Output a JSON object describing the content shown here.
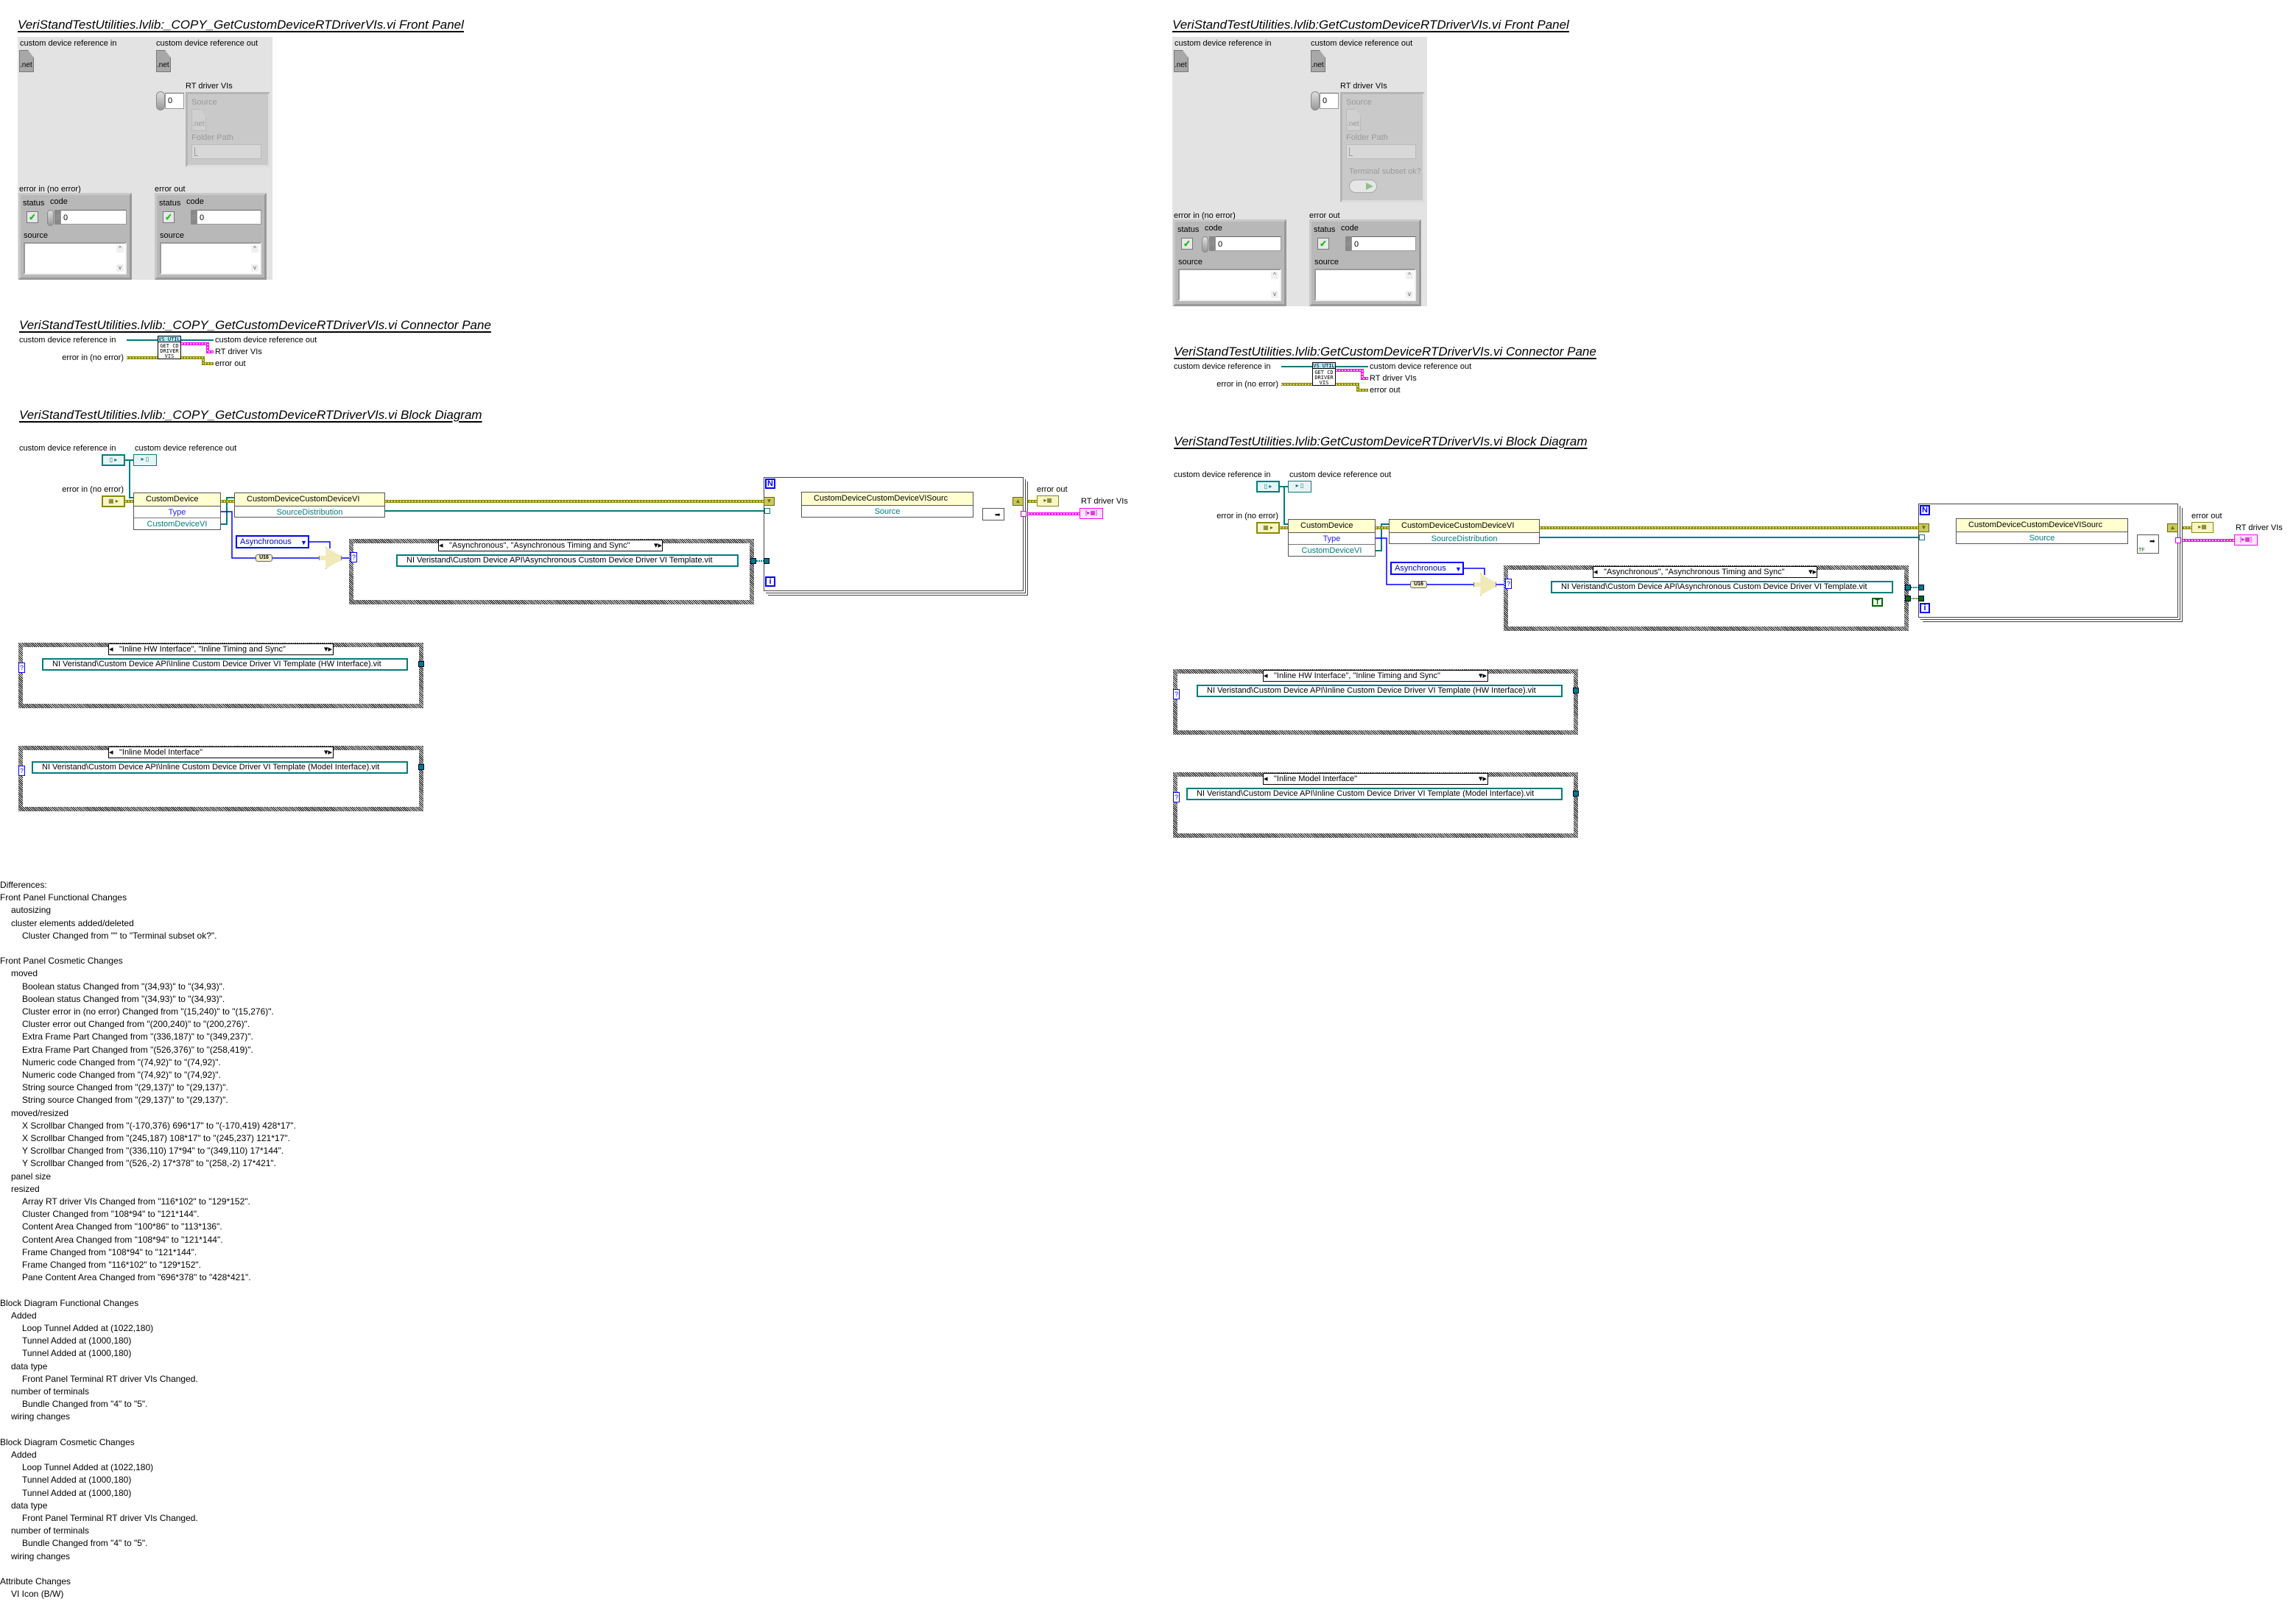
{
  "left": {
    "front_panel": {
      "title": "VeriStandTestUtilities.lvlib:_COPY_GetCustomDeviceRTDriverVIs.vi Front Panel",
      "ref_in_label": "custom device reference in",
      "ref_out_label": "custom device reference out",
      "net_icon_text": ".net",
      "array_label": "RT driver VIs",
      "array_index": "0",
      "source_label": "Source",
      "folder_path_label": "Folder Path",
      "error_in": {
        "label": "error in (no error)",
        "status_label": "status",
        "code_label": "code",
        "code_radix": "d",
        "code_value": "0",
        "source_label": "source",
        "status_value": "✓"
      },
      "error_out": {
        "label": "error out",
        "status_label": "status",
        "code_label": "code",
        "code_radix": "d",
        "code_value": "0",
        "source_label": "source",
        "status_value": "✓"
      }
    },
    "connector_pane": {
      "title": "VeriStandTestUtilities.lvlib:_COPY_GetCustomDeviceRTDriverVIs.vi Connector Pane",
      "ref_in": "custom device reference in",
      "error_in": "error in (no error)",
      "ref_out": "custom device reference out",
      "rt_driver_vis": "RT driver VIs",
      "error_out": "error out",
      "icon_lines": [
        "VS UTIL",
        "GET CD",
        "DRIVER",
        "VIS"
      ]
    },
    "block_diagram": {
      "title": "VeriStandTestUtilities.lvlib:_COPY_GetCustomDeviceRTDriverVIs.vi Block Diagram",
      "ref_in_label": "custom device reference in",
      "ref_out_label": "custom device reference out",
      "error_in_label": "error in (no error)",
      "property_node_1": {
        "class": "CustomDevice",
        "props": [
          "Type",
          "CustomDeviceVI"
        ]
      },
      "property_node_2": {
        "class": "CustomDeviceCustomDeviceVI",
        "props": [
          "SourceDistribution"
        ]
      },
      "enum_constant": "Asynchronous",
      "coerce_label": "U16",
      "case_selector_terminal": "?",
      "case_async": {
        "selector": "\"Asynchronous\", \"Asynchronous Timing and Sync\"",
        "path": "NI Veristand\\Custom Device API\\Asynchronous Custom Device Driver VI Template.vit"
      },
      "for_loop": {
        "count": "N",
        "index": "i"
      },
      "property_node_3": {
        "class": "CustomDeviceCustomDeviceVISourc",
        "props": [
          "Source"
        ]
      },
      "error_out_label": "error out",
      "rt_driver_vis_label": "RT driver VIs",
      "case_hw": {
        "selector": "\"Inline HW Interface\", \"Inline Timing and Sync\"",
        "path": "NI Veristand\\Custom Device API\\Inline Custom Device Driver VI Template (HW Interface).vit"
      },
      "case_model": {
        "selector": "\"Inline Model Interface\"",
        "path": "NI Veristand\\Custom Device API\\Inline Custom Device Driver VI Template (Model Interface).vit"
      }
    }
  },
  "right": {
    "front_panel": {
      "title": "VeriStandTestUtilities.lvlib:GetCustomDeviceRTDriverVIs.vi Front Panel",
      "ref_in_label": "custom device reference in",
      "ref_out_label": "custom device reference out",
      "net_icon_text": ".net",
      "array_label": "RT driver VIs",
      "array_index": "0",
      "source_label": "Source",
      "folder_path_label": "Folder Path",
      "terminal_subset_label": "Terminal subset ok?",
      "error_in": {
        "label": "error in (no error)",
        "status_label": "status",
        "code_label": "code",
        "code_radix": "d",
        "code_value": "0",
        "source_label": "source",
        "status_value": "✓"
      },
      "error_out": {
        "label": "error out",
        "status_label": "status",
        "code_label": "code",
        "code_radix": "d",
        "code_value": "0",
        "source_label": "source",
        "status_value": "✓"
      }
    },
    "connector_pane": {
      "title": "VeriStandTestUtilities.lvlib:GetCustomDeviceRTDriverVIs.vi Connector Pane",
      "ref_in": "custom device reference in",
      "error_in": "error in (no error)",
      "ref_out": "custom device reference out",
      "rt_driver_vis": "RT driver VIs",
      "error_out": "error out",
      "icon_lines": [
        "VS UTIL",
        "GET CD",
        "DRIVER",
        "VIS"
      ]
    },
    "block_diagram": {
      "title": "VeriStandTestUtilities.lvlib:GetCustomDeviceRTDriverVIs.vi Block Diagram",
      "ref_in_label": "custom device reference in",
      "ref_out_label": "custom device reference out",
      "error_in_label": "error in (no error)",
      "property_node_1": {
        "class": "CustomDevice",
        "props": [
          "Type",
          "CustomDeviceVI"
        ]
      },
      "property_node_2": {
        "class": "CustomDeviceCustomDeviceVI",
        "props": [
          "SourceDistribution"
        ]
      },
      "enum_constant": "Asynchronous",
      "coerce_label": "U16",
      "case_selector_terminal": "?",
      "case_async": {
        "selector": "\"Asynchronous\", \"Asynchronous Timing and Sync\"",
        "path": "NI Veristand\\Custom Device API\\Asynchronous Custom Device Driver VI Template.vit"
      },
      "bool_constant": "T",
      "for_loop": {
        "count": "N",
        "index": "i"
      },
      "property_node_3": {
        "class": "CustomDeviceCustomDeviceVISourc",
        "props": [
          "Source"
        ]
      },
      "bundle_bool_label": "TF",
      "error_out_label": "error out",
      "rt_driver_vis_label": "RT driver VIs",
      "case_hw": {
        "selector": "\"Inline HW Interface\", \"Inline Timing and Sync\"",
        "path": "NI Veristand\\Custom Device API\\Inline Custom Device Driver VI Template (HW Interface).vit"
      },
      "case_model": {
        "selector": "\"Inline Model Interface\"",
        "path": "NI Veristand\\Custom Device API\\Inline Custom Device Driver VI Template (Model Interface).vit"
      }
    }
  },
  "colors": {
    "error_wire": "#8a8a00",
    "reference_wire": "#007c7c",
    "cluster_array_wire": "#ff00ff",
    "enum_wire": "#0000ff",
    "boolean_wire": "#006600"
  },
  "differences": {
    "lines": [
      {
        "level": 0,
        "text": "Differences:"
      },
      {
        "level": 0,
        "text": "Front Panel Functional Changes"
      },
      {
        "level": 1,
        "text": "autosizing"
      },
      {
        "level": 1,
        "text": "cluster elements added/deleted"
      },
      {
        "level": 2,
        "text": "Cluster  Changed from \"\" to \"Terminal subset ok?\"."
      },
      {
        "level": 0,
        "text": ""
      },
      {
        "level": 0,
        "text": "Front Panel Cosmetic Changes"
      },
      {
        "level": 1,
        "text": "moved"
      },
      {
        "level": 2,
        "text": "Boolean status Changed from \"(34,93)\" to \"(34,93)\"."
      },
      {
        "level": 2,
        "text": "Boolean status Changed from \"(34,93)\" to \"(34,93)\"."
      },
      {
        "level": 2,
        "text": "Cluster error in (no error) Changed from \"(15,240)\" to \"(15,276)\"."
      },
      {
        "level": 2,
        "text": "Cluster error out Changed from \"(200,240)\" to \"(200,276)\"."
      },
      {
        "level": 2,
        "text": "Extra Frame Part  Changed from \"(336,187)\" to \"(349,237)\"."
      },
      {
        "level": 2,
        "text": "Extra Frame Part  Changed from \"(526,376)\" to \"(258,419)\"."
      },
      {
        "level": 2,
        "text": "Numeric code Changed from \"(74,92)\" to \"(74,92)\"."
      },
      {
        "level": 2,
        "text": "Numeric code Changed from \"(74,92)\" to \"(74,92)\"."
      },
      {
        "level": 2,
        "text": "String source Changed from \"(29,137)\" to \"(29,137)\"."
      },
      {
        "level": 2,
        "text": "String source Changed from \"(29,137)\" to \"(29,137)\"."
      },
      {
        "level": 1,
        "text": "moved/resized"
      },
      {
        "level": 2,
        "text": "X Scrollbar  Changed from \"(-170,376) 696*17\" to \"(-170,419) 428*17\"."
      },
      {
        "level": 2,
        "text": "X Scrollbar  Changed from \"(245,187) 108*17\" to \"(245,237) 121*17\"."
      },
      {
        "level": 2,
        "text": "Y Scrollbar  Changed from \"(336,110) 17*94\" to \"(349,110) 17*144\"."
      },
      {
        "level": 2,
        "text": "Y Scrollbar  Changed from \"(526,-2) 17*378\" to \"(258,-2) 17*421\"."
      },
      {
        "level": 1,
        "text": "panel size"
      },
      {
        "level": 1,
        "text": "resized"
      },
      {
        "level": 2,
        "text": "Array RT driver VIs Changed from \"116*102\" to \"129*152\"."
      },
      {
        "level": 2,
        "text": "Cluster  Changed from \"108*94\" to \"121*144\"."
      },
      {
        "level": 2,
        "text": "Content Area  Changed from \"100*86\" to \"113*136\"."
      },
      {
        "level": 2,
        "text": "Content Area  Changed from \"108*94\" to \"121*144\"."
      },
      {
        "level": 2,
        "text": "Frame  Changed from \"108*94\" to \"121*144\"."
      },
      {
        "level": 2,
        "text": "Frame  Changed from \"116*102\" to \"129*152\"."
      },
      {
        "level": 2,
        "text": "Pane Content Area  Changed from \"696*378\" to \"428*421\"."
      },
      {
        "level": 0,
        "text": ""
      },
      {
        "level": 0,
        "text": "Block Diagram Functional Changes"
      },
      {
        "level": 1,
        "text": "Added"
      },
      {
        "level": 2,
        "text": "Loop Tunnel  Added at (1022,180)"
      },
      {
        "level": 2,
        "text": "Tunnel  Added at (1000,180)"
      },
      {
        "level": 2,
        "text": "Tunnel  Added at (1000,180)"
      },
      {
        "level": 1,
        "text": "data type"
      },
      {
        "level": 2,
        "text": "Front Panel Terminal RT driver VIs Changed."
      },
      {
        "level": 1,
        "text": "number of terminals"
      },
      {
        "level": 2,
        "text": "Bundle  Changed from \"4\" to \"5\"."
      },
      {
        "level": 1,
        "text": "wiring changes"
      },
      {
        "level": 0,
        "text": ""
      },
      {
        "level": 0,
        "text": "Block Diagram Cosmetic Changes"
      },
      {
        "level": 1,
        "text": "Added"
      },
      {
        "level": 2,
        "text": "Loop Tunnel  Added at (1022,180)"
      },
      {
        "level": 2,
        "text": "Tunnel  Added at (1000,180)"
      },
      {
        "level": 2,
        "text": "Tunnel  Added at (1000,180)"
      },
      {
        "level": 1,
        "text": "data type"
      },
      {
        "level": 2,
        "text": "Front Panel Terminal RT driver VIs Changed."
      },
      {
        "level": 1,
        "text": "number of terminals"
      },
      {
        "level": 2,
        "text": "Bundle  Changed from \"4\" to \"5\"."
      },
      {
        "level": 1,
        "text": "wiring changes"
      },
      {
        "level": 0,
        "text": ""
      },
      {
        "level": 0,
        "text": "Attribute Changes"
      },
      {
        "level": 1,
        "text": "VI Icon (B/W)"
      }
    ]
  }
}
